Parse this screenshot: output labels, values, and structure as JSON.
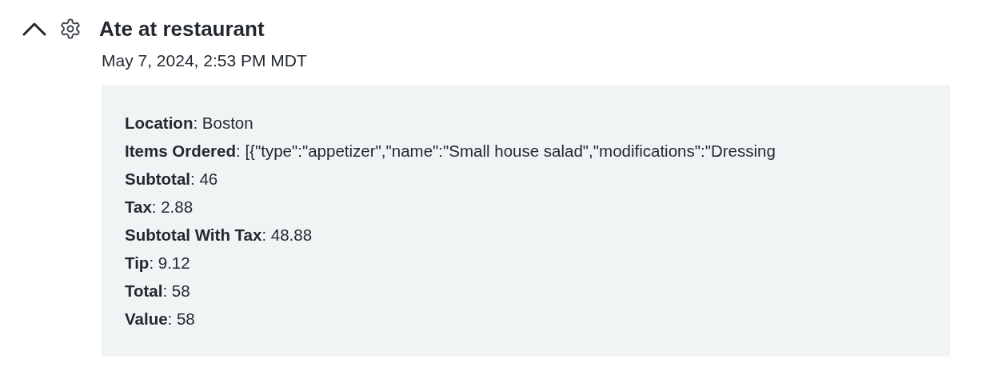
{
  "event": {
    "title": "Ate at restaurant",
    "expanded": true,
    "timestamp": "May 7, 2024, 2:53 PM MDT",
    "details": [
      {
        "text": "**Location**: Boston"
      },
      {
        "text": "**Items Ordered**: [{\"type\":\"appetizer\",\"name\":\"Small house salad\",\"modifications\":\"Dressing"
      },
      {
        "text": "**Subtotal**: 46"
      },
      {
        "text": "**Tax**: 2.88"
      },
      {
        "text": "**Subtotal With Tax**: 48.88"
      },
      {
        "text": "**Tip**: 9.12"
      },
      {
        "text": "**Total**: 58"
      },
      {
        "text": "**Value**: 58"
      }
    ]
  }
}
